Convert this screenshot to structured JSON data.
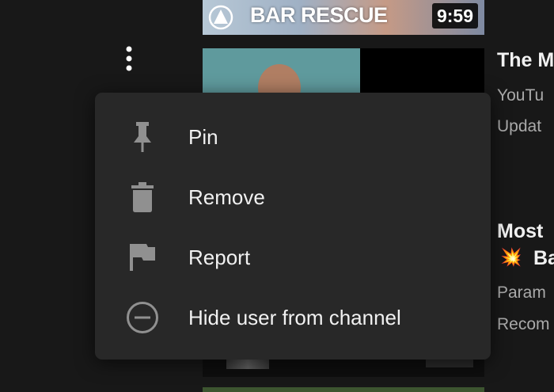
{
  "feed": {
    "top_video": {
      "thumbnail_title": "BAR RESCUE",
      "duration": "9:59"
    },
    "right_column": {
      "item1_title": "The M",
      "item1_meta1": "YouTu",
      "item1_meta2": "Updat",
      "item2_title": "Most",
      "item2_emoji": "💥",
      "item2_title2": "Ba",
      "item2_meta1": "Param",
      "item2_meta2": "Recom"
    }
  },
  "menu": {
    "items": [
      {
        "label": "Pin",
        "icon": "pin-icon"
      },
      {
        "label": "Remove",
        "icon": "trash-icon"
      },
      {
        "label": "Report",
        "icon": "flag-icon"
      },
      {
        "label": "Hide user from channel",
        "icon": "block-icon"
      }
    ]
  },
  "colors": {
    "background": "#181818",
    "menu_bg": "#282828",
    "text_primary": "#f1f1f1",
    "text_secondary": "#aaaaaa",
    "icon": "#909090"
  }
}
